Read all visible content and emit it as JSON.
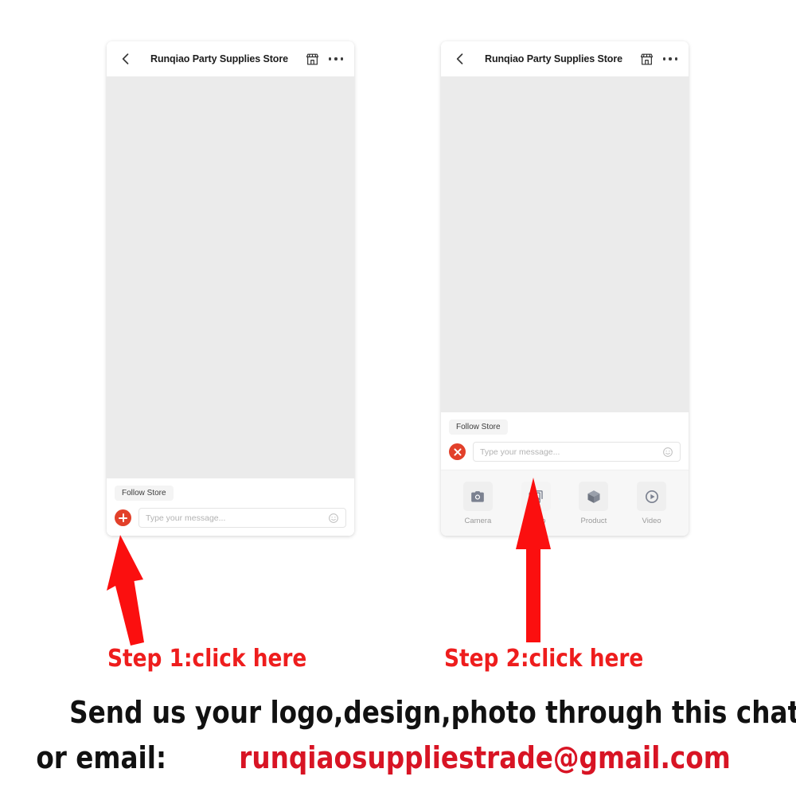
{
  "phones": [
    {
      "id": "phone-1",
      "topbar": {
        "title": "Runqiao Party Supplies Store",
        "back_icon": "back-arrow-icon",
        "store_icon": "storefront-icon",
        "more_icon": "more-options-icon"
      },
      "composer": {
        "follow_chip": "Follow Store",
        "action_button_icon": "plus-icon",
        "input_placeholder": "Type your message...",
        "input_value": "",
        "emoji_icon": "smiley-icon"
      },
      "tray_visible": false
    },
    {
      "id": "phone-2",
      "topbar": {
        "title": "Runqiao Party Supplies Store",
        "back_icon": "back-arrow-icon",
        "store_icon": "storefront-icon",
        "more_icon": "more-options-icon"
      },
      "composer": {
        "follow_chip": "Follow Store",
        "action_button_icon": "close-icon",
        "input_placeholder": "Type your message...",
        "input_value": "",
        "emoji_icon": "smiley-icon"
      },
      "tray_visible": true,
      "tray": [
        {
          "label": "Camera",
          "icon": "camera-icon",
          "highlighted": false
        },
        {
          "label": "Photo",
          "icon": "photo-icon",
          "highlighted": true
        },
        {
          "label": "Product",
          "icon": "product-cube-icon",
          "highlighted": false
        },
        {
          "label": "Video",
          "icon": "video-play-icon",
          "highlighted": false
        }
      ]
    }
  ],
  "annotations": {
    "arrow_1": "red-arrow-up-icon",
    "arrow_2": "red-arrow-up-icon",
    "step_1": "Step 1:click here",
    "step_2": "Step 2:click here"
  },
  "footer": {
    "line_1": "Send us your logo,design,photo through this chat window",
    "line_2_prefix": "or email:",
    "line_2_email": "runqiaosuppliestrade@gmail.com"
  },
  "colors": {
    "accent_red": "#e2402a",
    "annotation_red": "#ee1d1d",
    "email_red": "#d81424",
    "chat_bg": "#ebebeb",
    "tray_bg": "#f7f7f7"
  }
}
